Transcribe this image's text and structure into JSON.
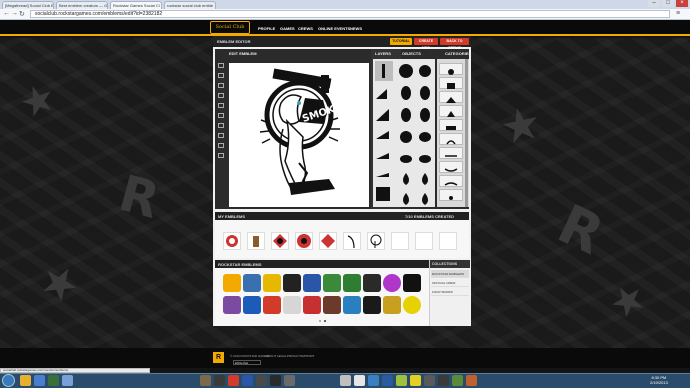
{
  "browser": {
    "tabs": [
      {
        "label": "[Megathread] Social Club Em"
      },
      {
        "label": "Best emblem creators — GT"
      },
      {
        "label": "Rockstar Games Social Cl"
      },
      {
        "label": "rockstar social club emble"
      }
    ],
    "url": "socialclub.rockstargames.com/emblems/edit?id=2382182"
  },
  "site": {
    "logo": "Social Club",
    "nav": [
      "PROFILE",
      "GAMES",
      "CREWS",
      "ONLINE EVENTS",
      "NEWS"
    ]
  },
  "editor": {
    "panel_title": "EMBLEM EDITOR",
    "tutorial": "TUTORIAL",
    "create_new": "CREATE NEW",
    "back_to_crews": "BACK TO CREWS",
    "edit_label": "EDIT EMBLEM",
    "layers": "LAYERS",
    "objects": "OBJECTS",
    "categories": "CATEGORIES",
    "canvas_text": "SMOKEY"
  },
  "my_emblems": {
    "title": "MY EMBLEMS",
    "count": "7/10 EMBLEMS CREATED"
  },
  "rockstar_emblems": {
    "title": "ROCKSTAR EMBLEMS",
    "collections_title": "COLLECTIONS",
    "collections": [
      "ROCKSTAR EMBLEMS",
      "OFFICIAL CREW",
      "FOUR WORDS"
    ]
  },
  "footer": {
    "links": [
      "© 2013 ROCKSTAR GAMES",
      "ABOUT",
      "LEGAL",
      "PRIVACY",
      "SUPPORT"
    ],
    "language": "ENGLISH"
  },
  "status": {
    "text": "socialclub.rockstargames.com/member/emblems"
  },
  "clock": {
    "time": "8:30 PM",
    "date": "2/19/2013"
  }
}
